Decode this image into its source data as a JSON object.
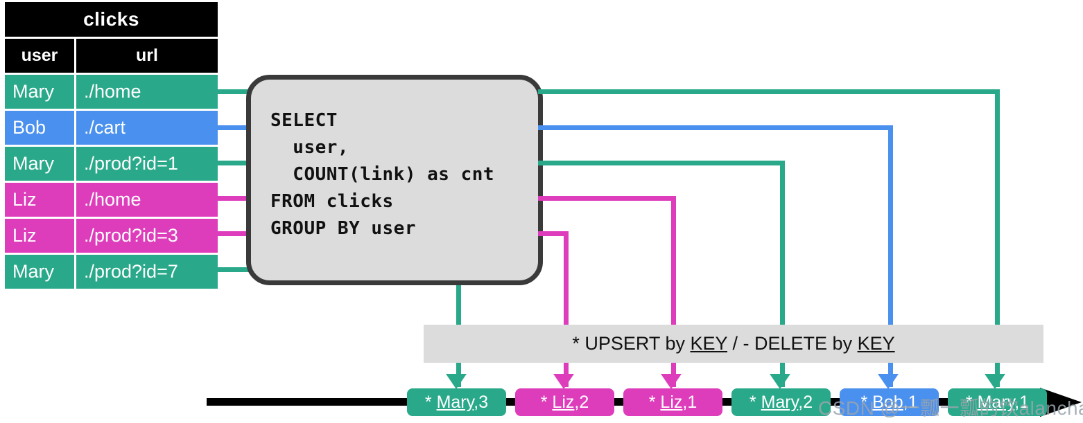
{
  "table": {
    "title": "clicks",
    "columns": [
      "user",
      "url"
    ],
    "rows": [
      {
        "user": "Mary",
        "url": "./home",
        "color": "teal"
      },
      {
        "user": "Bob",
        "url": "./cart",
        "color": "blue"
      },
      {
        "user": "Mary",
        "url": "./prod?id=1",
        "color": "teal"
      },
      {
        "user": "Liz",
        "url": "./home",
        "color": "pink"
      },
      {
        "user": "Liz",
        "url": "./prod?id=3",
        "color": "pink"
      },
      {
        "user": "Mary",
        "url": "./prod?id=7",
        "color": "teal"
      }
    ]
  },
  "sql": {
    "query": "SELECT\n  user,\n  COUNT(link) as cnt\nFROM clicks\nGROUP BY user"
  },
  "upsert_bar": {
    "prefix": "* UPSERT by ",
    "key1": "KEY",
    "middle": " / - DELETE by ",
    "key2": "KEY",
    "full_text": "* UPSERT by KEY / - DELETE by KEY"
  },
  "changelog": {
    "chips": [
      {
        "op": "*",
        "key": "Mary",
        "value": "3",
        "label": "* Mary,3",
        "color": "teal"
      },
      {
        "op": "*",
        "key": "Liz",
        "value": "2",
        "label": "* Liz,2",
        "color": "pink"
      },
      {
        "op": "*",
        "key": "Liz",
        "value": "1",
        "label": "* Liz,1",
        "color": "pink"
      },
      {
        "op": "*",
        "key": "Mary",
        "value": "2",
        "label": "* Mary,2",
        "color": "teal"
      },
      {
        "op": "*",
        "key": "Bob",
        "value": "1",
        "label": "* Bob,1",
        "color": "blue"
      },
      {
        "op": "*",
        "key": "Mary",
        "value": "1",
        "label": "* Mary,1",
        "color": "teal"
      }
    ]
  },
  "watermark": {
    "text": "CSDN @一瓢一瓢的饮alanchan"
  },
  "colors": {
    "teal": "#2aa98a",
    "blue": "#4a90ee",
    "pink": "#dd3dbb",
    "header": "#000000",
    "box_fill": "#dcdcdc",
    "box_border": "#3a3a3a",
    "timeline": "#000000"
  }
}
